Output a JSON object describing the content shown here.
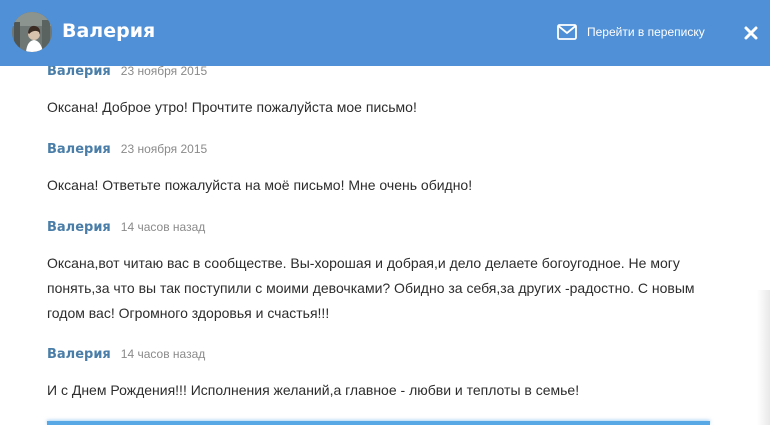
{
  "header": {
    "contact_name": "Валерия",
    "goto_label": "Перейти в переписку",
    "icons": {
      "avatar": "contact-photo",
      "goto": "envelope-icon",
      "close": "close-icon"
    },
    "colors": {
      "header_bg": "#4f90d6",
      "author": "#4a7ea8",
      "date": "#8a8a8a"
    }
  },
  "messages": [
    {
      "author": "Валерия",
      "date": "23 ноября 2015",
      "text": "Оксана! Доброе утро! Прочтите пожалуйста мое письмо!"
    },
    {
      "author": "Валерия",
      "date": "23 ноября 2015",
      "text": "Оксана! Ответьте пожалуйста на моё письмо! Мне очень обидно!"
    },
    {
      "author": "Валерия",
      "date": "14 часов назад",
      "text": "Оксана,вот читаю вас в сообществе. Вы-хорошая и добрая,и дело делаете богоугодное. Не могу понять,за что вы так поступили с моими девочками? Обидно за себя,за других -радостно. С новым годом вас! Огромного здоровья и счастья!!!"
    },
    {
      "author": "Валерия",
      "date": "14 часов назад",
      "text": "И с Днем Рождения!!! Исполнения желаний,а главное - любви и теплоты в семье!"
    }
  ]
}
